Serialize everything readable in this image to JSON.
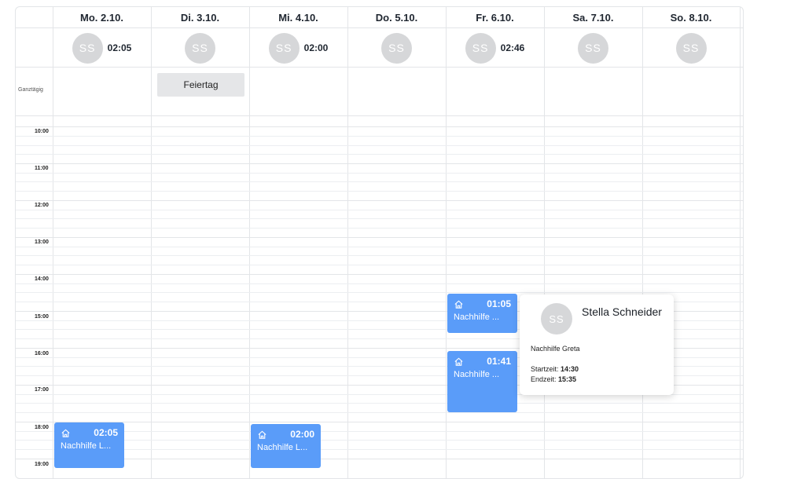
{
  "days": [
    {
      "label": "Mo. 2.10.",
      "avatar": "SS",
      "time": "02:05"
    },
    {
      "label": "Di. 3.10.",
      "avatar": "SS",
      "time": ""
    },
    {
      "label": "Mi. 4.10.",
      "avatar": "SS",
      "time": "02:00"
    },
    {
      "label": "Do. 5.10.",
      "avatar": "SS",
      "time": ""
    },
    {
      "label": "Fr. 6.10.",
      "avatar": "SS",
      "time": "02:46"
    },
    {
      "label": "Sa. 7.10.",
      "avatar": "SS",
      "time": ""
    },
    {
      "label": "So. 8.10.",
      "avatar": "SS",
      "time": ""
    }
  ],
  "allday_label": "Ganztägig",
  "holiday": {
    "label": "Feiertag"
  },
  "hours": [
    "10:00",
    "11:00",
    "12:00",
    "13:00",
    "14:00",
    "15:00",
    "16:00",
    "17:00",
    "18:00",
    "19:00"
  ],
  "events": [
    {
      "duration": "01:05",
      "title": "Nachhilfe ..."
    },
    {
      "duration": "01:41",
      "title": "Nachhilfe ..."
    },
    {
      "duration": "02:05",
      "title": "Nachhilfe L..."
    },
    {
      "duration": "02:00",
      "title": "Nachhilfe L..."
    }
  ],
  "popover": {
    "avatar": "SS",
    "name": "Stella Schneider",
    "course": "Nachhilfe Greta",
    "start_label": "Startzeit:",
    "start_value": "14:30",
    "end_label": "Endzeit:",
    "end_value": "15:35"
  },
  "colors": {
    "event": "#5a9cf9",
    "avatar": "#d6d7d9",
    "grid": "#e3e5e8"
  }
}
